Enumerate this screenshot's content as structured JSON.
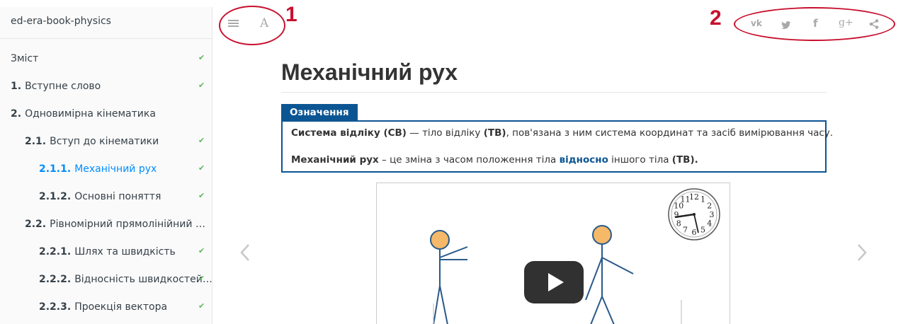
{
  "sidebar": {
    "title": "ed-era-book-physics",
    "items": [
      {
        "num": "",
        "label": "Зміст",
        "checked": true
      },
      {
        "num": "1.",
        "label": "Вступне слово",
        "checked": true
      },
      {
        "num": "2.",
        "label": "Одновимірна кінематика",
        "checked": false
      },
      {
        "num": "2.1.",
        "label": "Вступ до кінематики",
        "checked": true
      },
      {
        "num": "2.1.1.",
        "label": "Механічний рух",
        "checked": true,
        "active": true
      },
      {
        "num": "2.1.2.",
        "label": "Основні поняття",
        "checked": true
      },
      {
        "num": "2.2.",
        "label": "Рівномірний прямолінійний рух",
        "checked": false
      },
      {
        "num": "2.2.1.",
        "label": "Шлях та швидкість",
        "checked": true
      },
      {
        "num": "2.2.2.",
        "label": "Відносність швидкостей т...",
        "checked": true
      },
      {
        "num": "2.2.3.",
        "label": "Проекція вектора",
        "checked": true
      }
    ]
  },
  "toolbar": {
    "left_icons": [
      "menu-icon",
      "font-settings-icon"
    ],
    "font_glyph": "A",
    "share_icons": [
      "vk-icon",
      "twitter-icon",
      "facebook-icon",
      "google-plus-icon",
      "share-icon"
    ],
    "vk_glyph": "vk",
    "fb_glyph": "f",
    "gplus_glyph": "g+"
  },
  "annotations": {
    "label_1": "1",
    "label_2": "2",
    "color": "#c8102e"
  },
  "content": {
    "title": "Механічний рух",
    "definition": {
      "tab": "Означення",
      "line1_term": "Система відліку (СВ)",
      "line1_mid": " — тіло відліку ",
      "line1_tb": "(ТВ)",
      "line1_rest": ", пов'язана з ним система координат та засіб вимірювання часу.",
      "line2_term": "Механічний рух",
      "line2_mid": " – це зміна з часом положення тіла ",
      "line2_hl": "відносно",
      "line2_mid2": " іншого тіла ",
      "line2_tb": "(ТВ)."
    },
    "video": {
      "play_icon": "play-icon",
      "clock_numbers": [
        "12",
        "1",
        "2",
        "3",
        "4",
        "5",
        "6",
        "7",
        "8",
        "9",
        "10",
        "11"
      ]
    }
  },
  "colors": {
    "accent_blue": "#0c5593",
    "active_link": "#008cff",
    "check_green": "#5cb85c"
  }
}
